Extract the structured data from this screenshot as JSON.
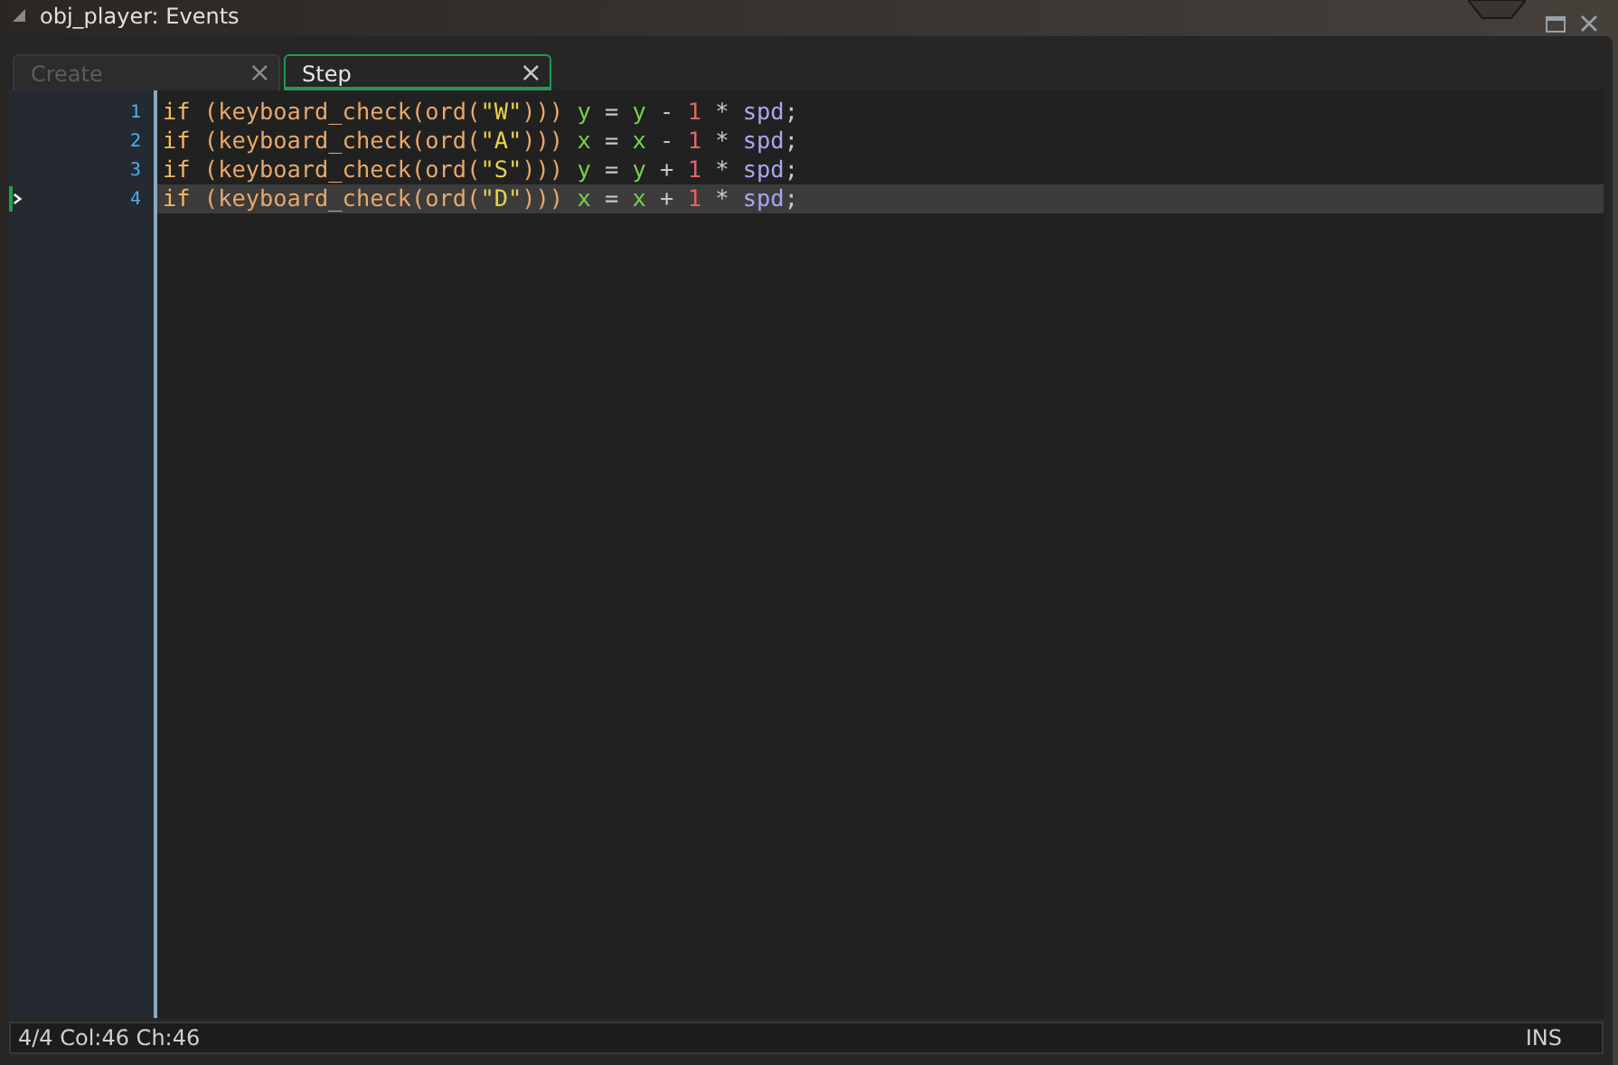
{
  "window": {
    "title": "obj_player: Events"
  },
  "tabs": [
    {
      "label": "Create",
      "selected": false,
      "close": "×"
    },
    {
      "label": "Step",
      "selected": true,
      "close": "×"
    }
  ],
  "code_lines": [
    {
      "number": "1",
      "current": false,
      "tokens": [
        {
          "kind": "keyword",
          "text": "if"
        },
        {
          "kind": "punct",
          "text": " ("
        },
        {
          "kind": "function",
          "text": "keyboard_check"
        },
        {
          "kind": "punct",
          "text": "("
        },
        {
          "kind": "function",
          "text": "ord"
        },
        {
          "kind": "punct",
          "text": "("
        },
        {
          "kind": "string",
          "text": "\"W\""
        },
        {
          "kind": "punct",
          "text": "))) "
        },
        {
          "kind": "variable",
          "text": "y"
        },
        {
          "kind": "operator",
          "text": " = "
        },
        {
          "kind": "variable",
          "text": "y"
        },
        {
          "kind": "operator",
          "text": " - "
        },
        {
          "kind": "number",
          "text": "1"
        },
        {
          "kind": "operator",
          "text": " * "
        },
        {
          "kind": "identifier",
          "text": "spd"
        },
        {
          "kind": "operator",
          "text": ";"
        }
      ]
    },
    {
      "number": "2",
      "current": false,
      "tokens": [
        {
          "kind": "keyword",
          "text": "if"
        },
        {
          "kind": "punct",
          "text": " ("
        },
        {
          "kind": "function",
          "text": "keyboard_check"
        },
        {
          "kind": "punct",
          "text": "("
        },
        {
          "kind": "function",
          "text": "ord"
        },
        {
          "kind": "punct",
          "text": "("
        },
        {
          "kind": "string",
          "text": "\"A\""
        },
        {
          "kind": "punct",
          "text": "))) "
        },
        {
          "kind": "variable",
          "text": "x"
        },
        {
          "kind": "operator",
          "text": " = "
        },
        {
          "kind": "variable",
          "text": "x"
        },
        {
          "kind": "operator",
          "text": " - "
        },
        {
          "kind": "number",
          "text": "1"
        },
        {
          "kind": "operator",
          "text": " * "
        },
        {
          "kind": "identifier",
          "text": "spd"
        },
        {
          "kind": "operator",
          "text": ";"
        }
      ]
    },
    {
      "number": "3",
      "current": false,
      "tokens": [
        {
          "kind": "keyword",
          "text": "if"
        },
        {
          "kind": "punct",
          "text": " ("
        },
        {
          "kind": "function",
          "text": "keyboard_check"
        },
        {
          "kind": "punct",
          "text": "("
        },
        {
          "kind": "function",
          "text": "ord"
        },
        {
          "kind": "punct",
          "text": "("
        },
        {
          "kind": "string",
          "text": "\"S\""
        },
        {
          "kind": "punct",
          "text": "))) "
        },
        {
          "kind": "variable",
          "text": "y"
        },
        {
          "kind": "operator",
          "text": " = "
        },
        {
          "kind": "variable",
          "text": "y"
        },
        {
          "kind": "operator",
          "text": " + "
        },
        {
          "kind": "number",
          "text": "1"
        },
        {
          "kind": "operator",
          "text": " * "
        },
        {
          "kind": "identifier",
          "text": "spd"
        },
        {
          "kind": "operator",
          "text": ";"
        }
      ]
    },
    {
      "number": "4",
      "current": true,
      "tokens": [
        {
          "kind": "keyword",
          "text": "if"
        },
        {
          "kind": "punct",
          "text": " ("
        },
        {
          "kind": "function",
          "text": "keyboard_check"
        },
        {
          "kind": "punct",
          "text": "("
        },
        {
          "kind": "function",
          "text": "ord"
        },
        {
          "kind": "punct",
          "text": "("
        },
        {
          "kind": "string",
          "text": "\"D\""
        },
        {
          "kind": "punct",
          "text": "))) "
        },
        {
          "kind": "variable",
          "text": "x"
        },
        {
          "kind": "operator",
          "text": " = "
        },
        {
          "kind": "variable",
          "text": "x"
        },
        {
          "kind": "operator",
          "text": " + "
        },
        {
          "kind": "number",
          "text": "1"
        },
        {
          "kind": "operator",
          "text": " * "
        },
        {
          "kind": "identifier",
          "text": "spd"
        },
        {
          "kind": "operator",
          "text": ";"
        }
      ]
    }
  ],
  "status_bar": {
    "position": "4/4 Col:46 Ch:46",
    "mode": "INS"
  }
}
